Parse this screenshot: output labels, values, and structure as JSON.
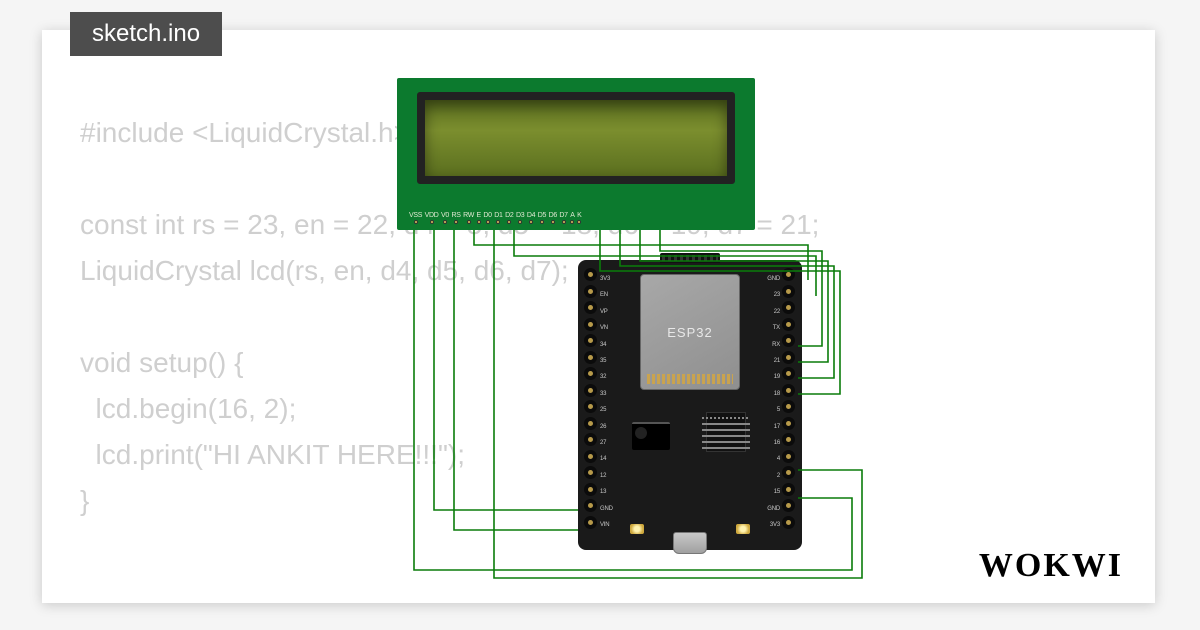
{
  "tab": {
    "filename": "sketch.ino"
  },
  "code": {
    "lines": [
      "#include <LiquidCrystal.h>",
      "",
      "const int rs = 23, en = 22, d4 = 5, d5 = 18, d6 = 19, d7 = 21;",
      "LiquidCrystal lcd(rs, en, d4, d5, d6, d7);",
      "",
      "void setup() {",
      "  lcd.begin(16, 2);",
      "  lcd.print(\"HI ANKIT HERE!!!\");",
      "}"
    ]
  },
  "lcd": {
    "type": "16x2 Character LCD",
    "pins": [
      "VSS",
      "VDD",
      "V0",
      "RS",
      "RW",
      "E",
      "D0",
      "D1",
      "D2",
      "D3",
      "D4",
      "D5",
      "D6",
      "D7",
      "A",
      "K"
    ]
  },
  "esp32": {
    "shield_label": "ESP32",
    "left_pins": [
      "3V3",
      "EN",
      "VP",
      "VN",
      "34",
      "35",
      "32",
      "33",
      "25",
      "26",
      "27",
      "14",
      "12",
      "13",
      "GND",
      "VIN"
    ],
    "right_pins": [
      "GND",
      "23",
      "22",
      "TX",
      "RX",
      "21",
      "19",
      "18",
      "5",
      "17",
      "16",
      "4",
      "2",
      "15",
      "GND",
      "3V3"
    ]
  },
  "brand": "WOKWI",
  "wiring": [
    {
      "from": "LCD.RS",
      "to": "ESP32.23"
    },
    {
      "from": "LCD.E",
      "to": "ESP32.22"
    },
    {
      "from": "LCD.D4",
      "to": "ESP32.5"
    },
    {
      "from": "LCD.D5",
      "to": "ESP32.18"
    },
    {
      "from": "LCD.D6",
      "to": "ESP32.19"
    },
    {
      "from": "LCD.D7",
      "to": "ESP32.21"
    },
    {
      "from": "LCD.VSS",
      "to": "ESP32.GND"
    },
    {
      "from": "LCD.RW",
      "to": "ESP32.GND"
    }
  ],
  "colors": {
    "pcb_green": "#0c7a2e",
    "lcd_backlight": "#7b8e2e",
    "wire_green": "#0a7c0a",
    "board_black": "#1a1a1a",
    "code_grey": "#cfcfcf"
  }
}
